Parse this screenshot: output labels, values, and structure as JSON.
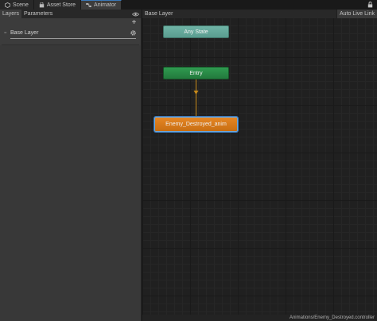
{
  "tabs": [
    {
      "label": "Scene",
      "icon": "scene-icon"
    },
    {
      "label": "Asset Store",
      "icon": "asset-store-icon"
    },
    {
      "label": "Animator",
      "icon": "animator-icon",
      "active": true
    }
  ],
  "left_panel": {
    "tabs": [
      "Layers",
      "Parameters"
    ],
    "layers": [
      {
        "label": "Base Layer"
      }
    ]
  },
  "graph": {
    "breadcrumb": "Base Layer",
    "auto_live_link": "Auto Live Link",
    "nodes": {
      "any_state": "Any State",
      "entry": "Entry",
      "state": "Enemy_Destroyed_anim"
    },
    "footer_path": "Animations/Enemy_Destroyed.controller"
  },
  "colors": {
    "accent": "#3a79bb",
    "any_state": "#5fa496",
    "entry": "#2a8a46",
    "default_state": "#d6781a",
    "transition": "#c78a1a"
  }
}
